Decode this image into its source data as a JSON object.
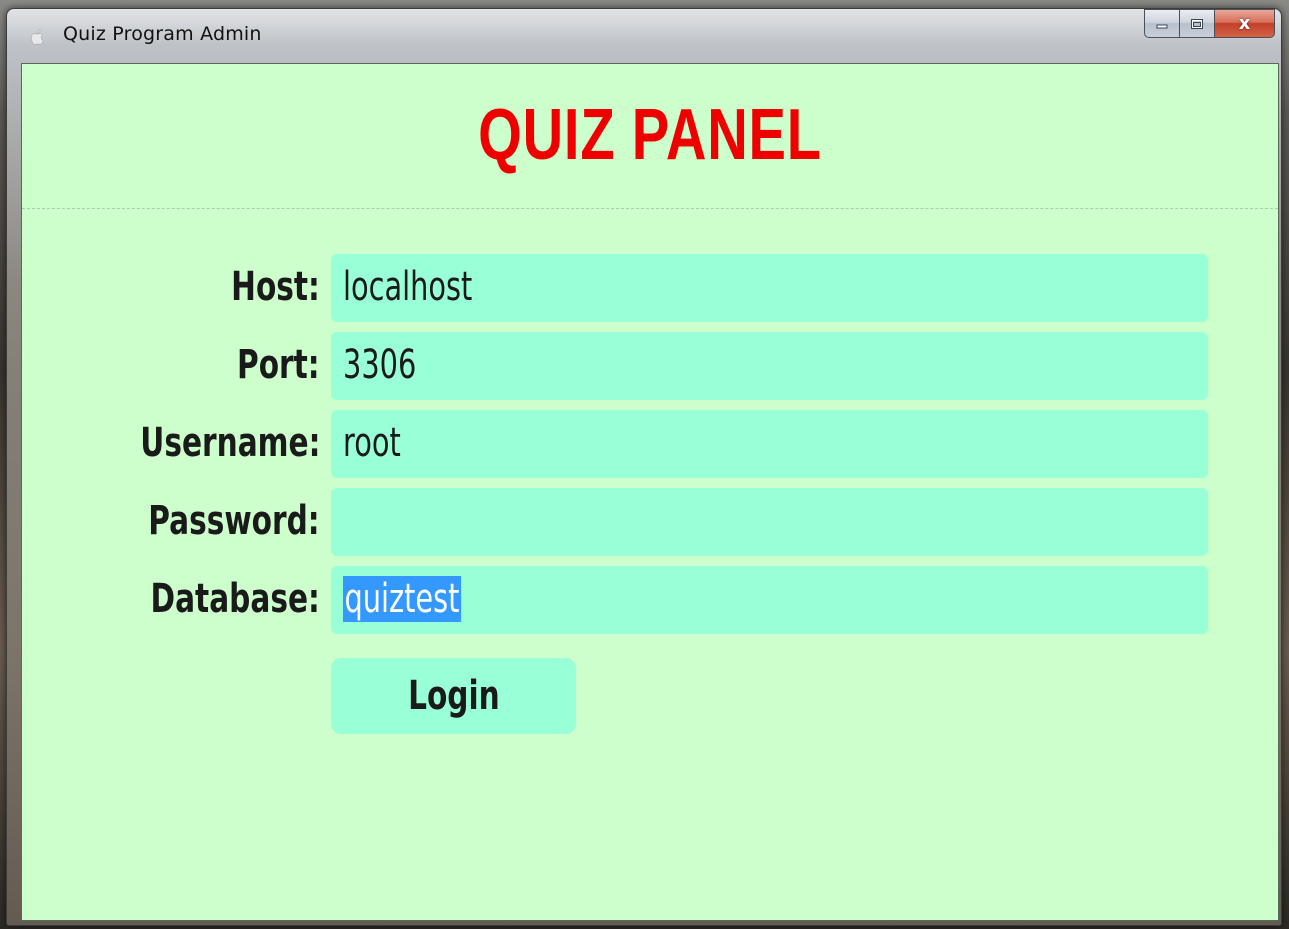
{
  "window": {
    "title": "Quiz Program Admin",
    "app_icon": "apple-icon",
    "caption_buttons": [
      "minimize-icon",
      "maximize-icon",
      "close-icon"
    ],
    "close_glyph": "x"
  },
  "panel": {
    "title": "QUIZ PANEL",
    "title_color": "#ee0000",
    "background_color": "#ccffcc",
    "field_color": "#99ffd6"
  },
  "form": {
    "host": {
      "label": "Host:",
      "value": "localhost"
    },
    "port": {
      "label": "Port:",
      "value": "3306"
    },
    "username": {
      "label": "Username:",
      "value": "root"
    },
    "password": {
      "label": "Password:",
      "value": ""
    },
    "database": {
      "label": "Database:",
      "value": "quiztest",
      "selected": true
    }
  },
  "login_button": {
    "label": "Login"
  }
}
